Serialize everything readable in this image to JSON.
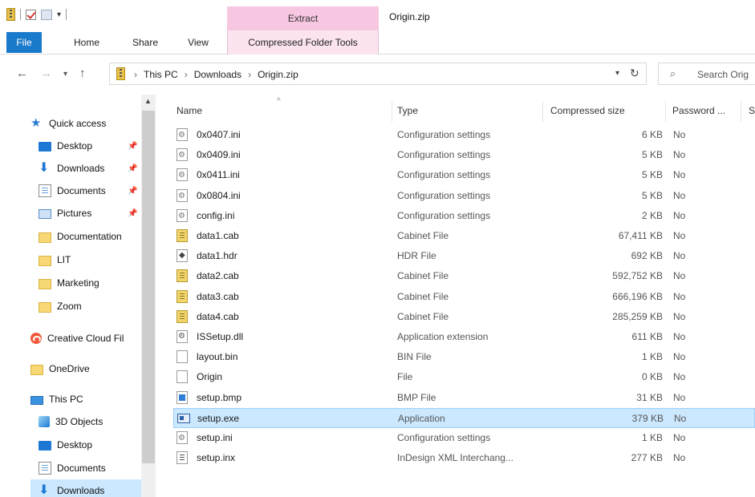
{
  "window": {
    "title": "Origin.zip",
    "context_tab": "Extract"
  },
  "ribbon": {
    "tabs": [
      "File",
      "Home",
      "Share",
      "View",
      "Compressed Folder Tools"
    ]
  },
  "address": {
    "crumbs": [
      "This PC",
      "Downloads",
      "Origin.zip"
    ],
    "separator": "›"
  },
  "search": {
    "placeholder": "Search Orig"
  },
  "nav": {
    "items": [
      {
        "label": "Quick access",
        "icon": "star-icon"
      },
      {
        "label": "Desktop",
        "icon": "desktop-icon",
        "pinned": true
      },
      {
        "label": "Downloads",
        "icon": "download-icon",
        "pinned": true
      },
      {
        "label": "Documents",
        "icon": "document-icon",
        "pinned": true
      },
      {
        "label": "Pictures",
        "icon": "pictures-icon",
        "pinned": true
      },
      {
        "label": "Documentation",
        "icon": "folder-icon"
      },
      {
        "label": "LIT",
        "icon": "folder-icon"
      },
      {
        "label": "Marketing",
        "icon": "folder-icon"
      },
      {
        "label": "Zoom",
        "icon": "folder-icon"
      },
      {
        "label": "Creative Cloud Fil",
        "icon": "creative-cloud-icon"
      },
      {
        "label": "OneDrive",
        "icon": "folder-icon"
      },
      {
        "label": "This PC",
        "icon": "computer-icon"
      },
      {
        "label": "3D Objects",
        "icon": "3d-objects-icon"
      },
      {
        "label": "Desktop",
        "icon": "desktop-icon"
      },
      {
        "label": "Documents",
        "icon": "document-icon"
      },
      {
        "label": "Downloads",
        "icon": "download-icon",
        "selected": true
      }
    ]
  },
  "columns": {
    "name": "Name",
    "type": "Type",
    "size": "Compressed size",
    "password": "Password ...",
    "extra": "S"
  },
  "files": [
    {
      "name": "0x0407.ini",
      "type": "Configuration settings",
      "size": "6 KB",
      "password": "No",
      "icon": "ini"
    },
    {
      "name": "0x0409.ini",
      "type": "Configuration settings",
      "size": "5 KB",
      "password": "No",
      "icon": "ini"
    },
    {
      "name": "0x0411.ini",
      "type": "Configuration settings",
      "size": "5 KB",
      "password": "No",
      "icon": "ini"
    },
    {
      "name": "0x0804.ini",
      "type": "Configuration settings",
      "size": "5 KB",
      "password": "No",
      "icon": "ini"
    },
    {
      "name": "config.ini",
      "type": "Configuration settings",
      "size": "2 KB",
      "password": "No",
      "icon": "ini"
    },
    {
      "name": "data1.cab",
      "type": "Cabinet File",
      "size": "67,411 KB",
      "password": "No",
      "icon": "cab"
    },
    {
      "name": "data1.hdr",
      "type": "HDR File",
      "size": "692 KB",
      "password": "No",
      "icon": "hdr"
    },
    {
      "name": "data2.cab",
      "type": "Cabinet File",
      "size": "592,752 KB",
      "password": "No",
      "icon": "cab"
    },
    {
      "name": "data3.cab",
      "type": "Cabinet File",
      "size": "666,196 KB",
      "password": "No",
      "icon": "cab"
    },
    {
      "name": "data4.cab",
      "type": "Cabinet File",
      "size": "285,259 KB",
      "password": "No",
      "icon": "cab"
    },
    {
      "name": "ISSetup.dll",
      "type": "Application extension",
      "size": "611 KB",
      "password": "No",
      "icon": "dll"
    },
    {
      "name": "layout.bin",
      "type": "BIN File",
      "size": "1 KB",
      "password": "No",
      "icon": "blank"
    },
    {
      "name": "Origin",
      "type": "File",
      "size": "0 KB",
      "password": "No",
      "icon": "blank"
    },
    {
      "name": "setup.bmp",
      "type": "BMP File",
      "size": "31 KB",
      "password": "No",
      "icon": "bmp"
    },
    {
      "name": "setup.exe",
      "type": "Application",
      "size": "379 KB",
      "password": "No",
      "icon": "exe",
      "selected": true
    },
    {
      "name": "setup.ini",
      "type": "Configuration settings",
      "size": "1 KB",
      "password": "No",
      "icon": "ini"
    },
    {
      "name": "setup.inx",
      "type": "InDesign XML Interchang...",
      "size": "277 KB",
      "password": "No",
      "icon": "inx"
    }
  ]
}
